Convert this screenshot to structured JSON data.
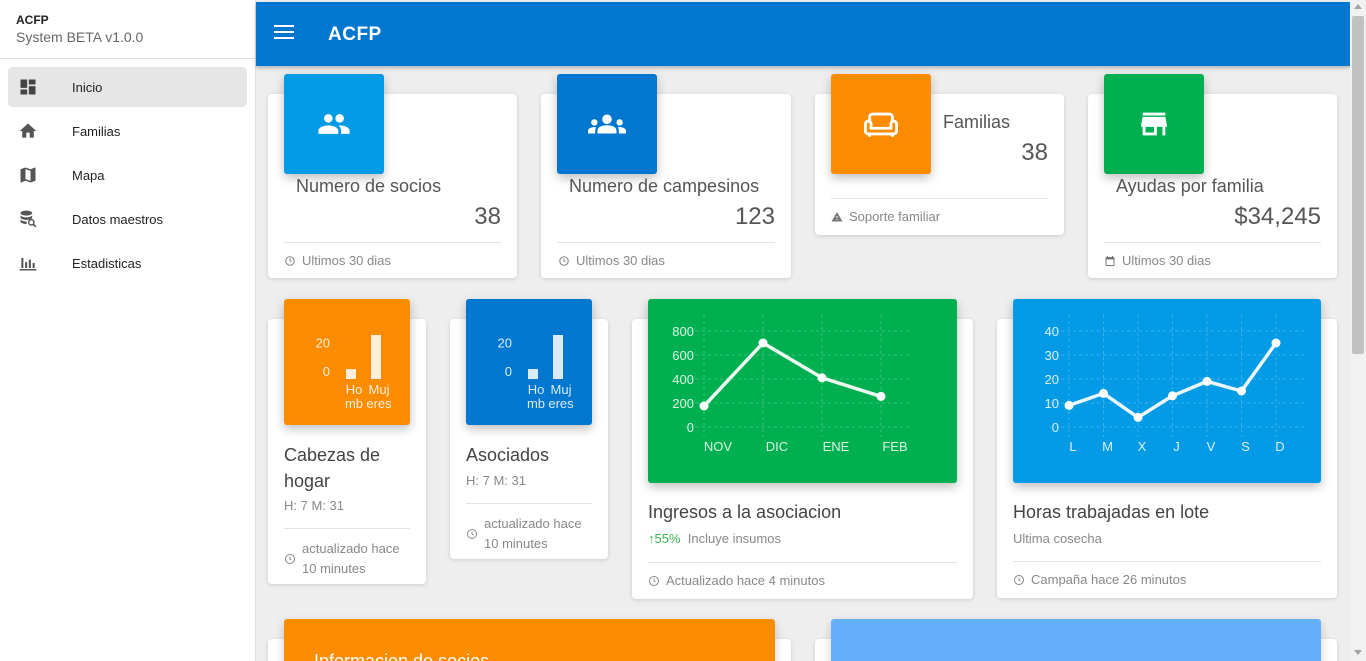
{
  "sidebar": {
    "title": "ACFP",
    "subtitle": "System BETA v1.0.0",
    "items": [
      {
        "label": "Inicio",
        "icon": "dashboard-icon"
      },
      {
        "label": "Familias",
        "icon": "home-icon"
      },
      {
        "label": "Mapa",
        "icon": "map-icon"
      },
      {
        "label": "Datos maestros",
        "icon": "database-search-icon"
      },
      {
        "label": "Estadisticas",
        "icon": "bar-chart-icon"
      }
    ]
  },
  "appbar": {
    "title": "ACFP"
  },
  "stats": [
    {
      "label": "Numero de socios",
      "value": "38",
      "footer": "Ultimos 30 dias",
      "color": "#039be5",
      "icon": "people-icon"
    },
    {
      "label": "Numero de campesinos",
      "value": "123",
      "footer": "Ultimos 30 dias",
      "color": "#0277cf",
      "icon": "group-icon"
    },
    {
      "label": "Familias",
      "value": "38",
      "footer": "Soporte familiar",
      "color": "#fb8c00",
      "icon": "sofa-icon"
    },
    {
      "label": "Ayudas por familia",
      "value": "$34,245",
      "footer": "Ultimos 30 dias",
      "color": "#00b050",
      "icon": "store-icon"
    }
  ],
  "small_charts": [
    {
      "title": "Cabezas de hogar",
      "sub": "H: 7 M: 31",
      "footer": "actualizado hace 10 minutes",
      "color": "#fb8c00"
    },
    {
      "title": "Asociados",
      "sub": "H: 7 M: 31",
      "footer": "actualizado hace 10 minutes",
      "color": "#0277cf"
    }
  ],
  "big_charts": [
    {
      "title": "Ingresos a la asociacion",
      "growth": "55%",
      "sub": "Incluye insumos",
      "footer": "Actualizado hace 4 minutos",
      "color": "#00b050"
    },
    {
      "title": "Horas trabajadas en lote",
      "sub": "Ultima cosecha",
      "footer": "Campaña hace 26 minutos",
      "color": "#039be5"
    }
  ],
  "bottom": [
    {
      "title": "Informacion de socios",
      "color": "#fb8c00"
    },
    {
      "title": "",
      "color": "#64b0fc"
    }
  ],
  "chart_data": [
    {
      "type": "bar",
      "title": "Cabezas de hogar",
      "categories": [
        "Hombres",
        "Mujeres"
      ],
      "category_lines": [
        [
          "Ho",
          "mb"
        ],
        [
          "Muj",
          "eres"
        ]
      ],
      "values": [
        7,
        31
      ],
      "yticks": [
        "0",
        "20"
      ],
      "ylim": [
        0,
        31
      ]
    },
    {
      "type": "bar",
      "title": "Asociados",
      "categories": [
        "Hombres",
        "Mujeres"
      ],
      "category_lines": [
        [
          "Ho",
          "mb"
        ],
        [
          "Muj",
          "eres"
        ]
      ],
      "values": [
        7,
        31
      ],
      "yticks": [
        "0",
        "20"
      ],
      "ylim": [
        0,
        31
      ]
    },
    {
      "type": "line",
      "title": "Ingresos a la asociacion",
      "categories": [
        "NOV",
        "DIC",
        "ENE",
        "FEB"
      ],
      "values": [
        175,
        700,
        410,
        255
      ],
      "yticks": [
        "0",
        "200",
        "400",
        "600",
        "800"
      ],
      "ylim": [
        0,
        800
      ]
    },
    {
      "type": "line",
      "title": "Horas trabajadas en lote",
      "categories": [
        "L",
        "M",
        "X",
        "J",
        "V",
        "S",
        "D"
      ],
      "values": [
        9,
        14,
        4,
        13,
        19,
        15,
        35
      ],
      "yticks": [
        "0",
        "10",
        "20",
        "30",
        "40"
      ],
      "ylim": [
        0,
        40
      ]
    }
  ]
}
